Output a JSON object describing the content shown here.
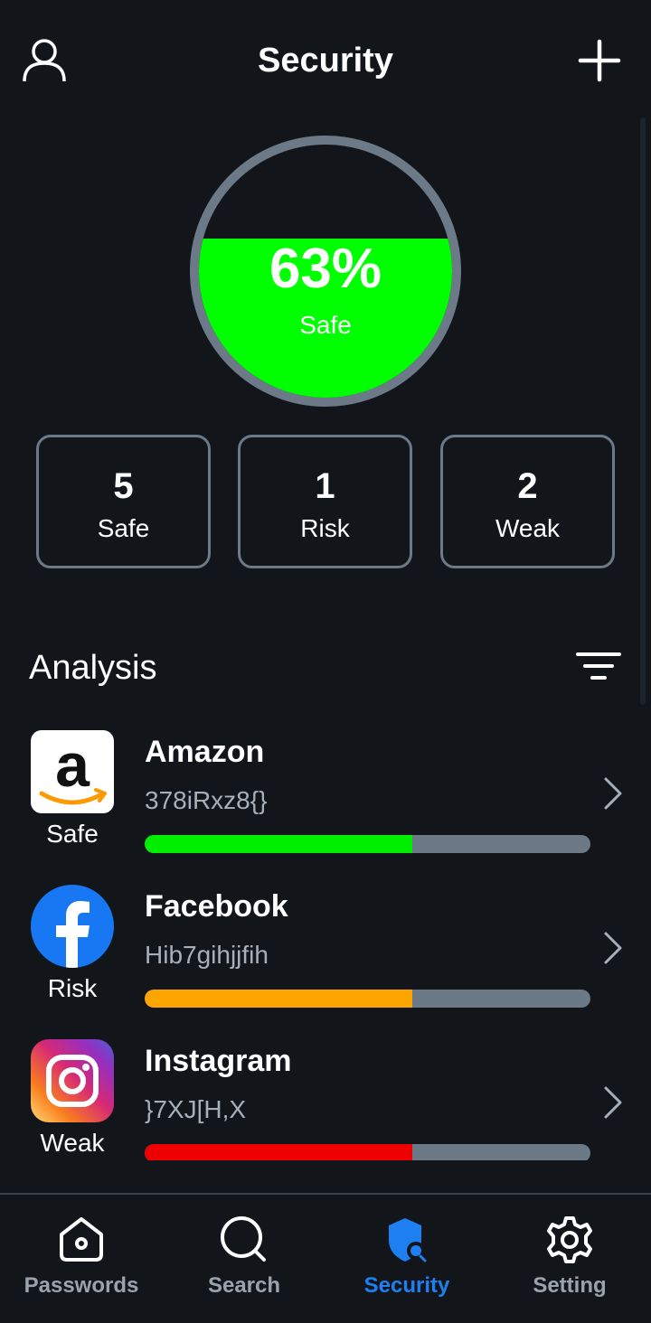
{
  "header": {
    "title": "Security"
  },
  "gauge": {
    "percent_text": "63%",
    "label": "Safe",
    "fill_fraction": 0.63,
    "fill_color": "#00ff00"
  },
  "stats": [
    {
      "count": "5",
      "label": "Safe"
    },
    {
      "count": "1",
      "label": "Risk"
    },
    {
      "count": "2",
      "label": "Weak"
    }
  ],
  "analysis": {
    "title": "Analysis",
    "items": [
      {
        "name": "Amazon",
        "password": "378iRxz8{}",
        "status": "Safe",
        "strength": 0.6,
        "bar_color": "#00ee00",
        "icon": "amazon-logo"
      },
      {
        "name": "Facebook",
        "password": "Hib7gihjjfih",
        "status": "Risk",
        "strength": 0.6,
        "bar_color": "#ffa500",
        "icon": "facebook-logo"
      },
      {
        "name": "Instagram",
        "password": "}7XJ[H,X",
        "status": "Weak",
        "strength": 0.6,
        "bar_color": "#ee0000",
        "icon": "instagram-logo"
      }
    ]
  },
  "nav": [
    {
      "label": "Passwords",
      "icon": "home-icon"
    },
    {
      "label": "Search",
      "icon": "search-icon"
    },
    {
      "label": "Security",
      "icon": "shield-icon",
      "active": true
    },
    {
      "label": "Setting",
      "icon": "gear-icon"
    }
  ],
  "colors": {
    "background": "#12161b",
    "accent": "#1e7ff0",
    "border": "#6c7a88"
  }
}
